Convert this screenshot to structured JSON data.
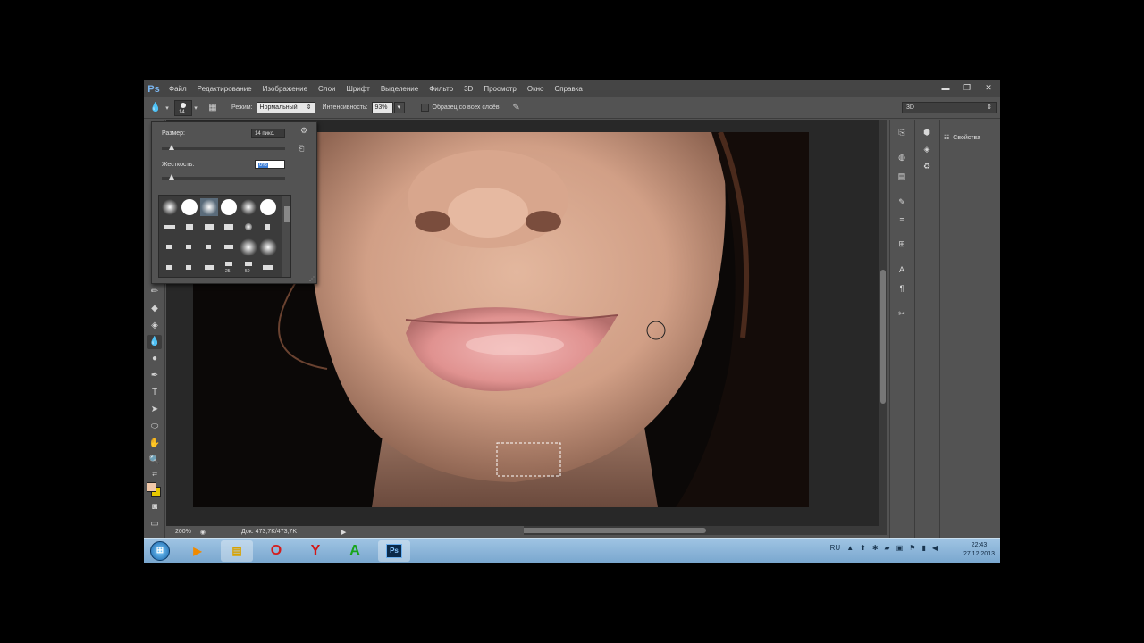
{
  "app": {
    "logo": "Ps"
  },
  "menu": [
    "Файл",
    "Редактирование",
    "Изображение",
    "Слои",
    "Шрифт",
    "Выделение",
    "Фильтр",
    "3D",
    "Просмотр",
    "Окно",
    "Справка"
  ],
  "window_controls": {
    "minimize": "▬",
    "restore": "❐",
    "close": "✕"
  },
  "options": {
    "brush_size": "14",
    "mode_label": "Режим:",
    "mode_value": "Нормальный",
    "intensity_label": "Интенсивность:",
    "intensity_value": "93%",
    "sample_all_label": "Образец со всех слоёв",
    "workspace": "3D"
  },
  "brush_popup": {
    "size_label": "Размер:",
    "size_value": "14 пикс.",
    "hardness_label": "Жесткость:",
    "hardness_value": "0%",
    "size_slider": 0.06,
    "hardness_slider": 0.0,
    "preset_numbers": [
      "25",
      "50"
    ]
  },
  "status": {
    "zoom": "200%",
    "doc": "Док: 473,7K/473,7K"
  },
  "panels": {
    "properties": "Свойства"
  },
  "taskbar": {
    "lang": "RU",
    "time": "22:43",
    "date": "27.12.2013",
    "ps_label": "Ps"
  }
}
